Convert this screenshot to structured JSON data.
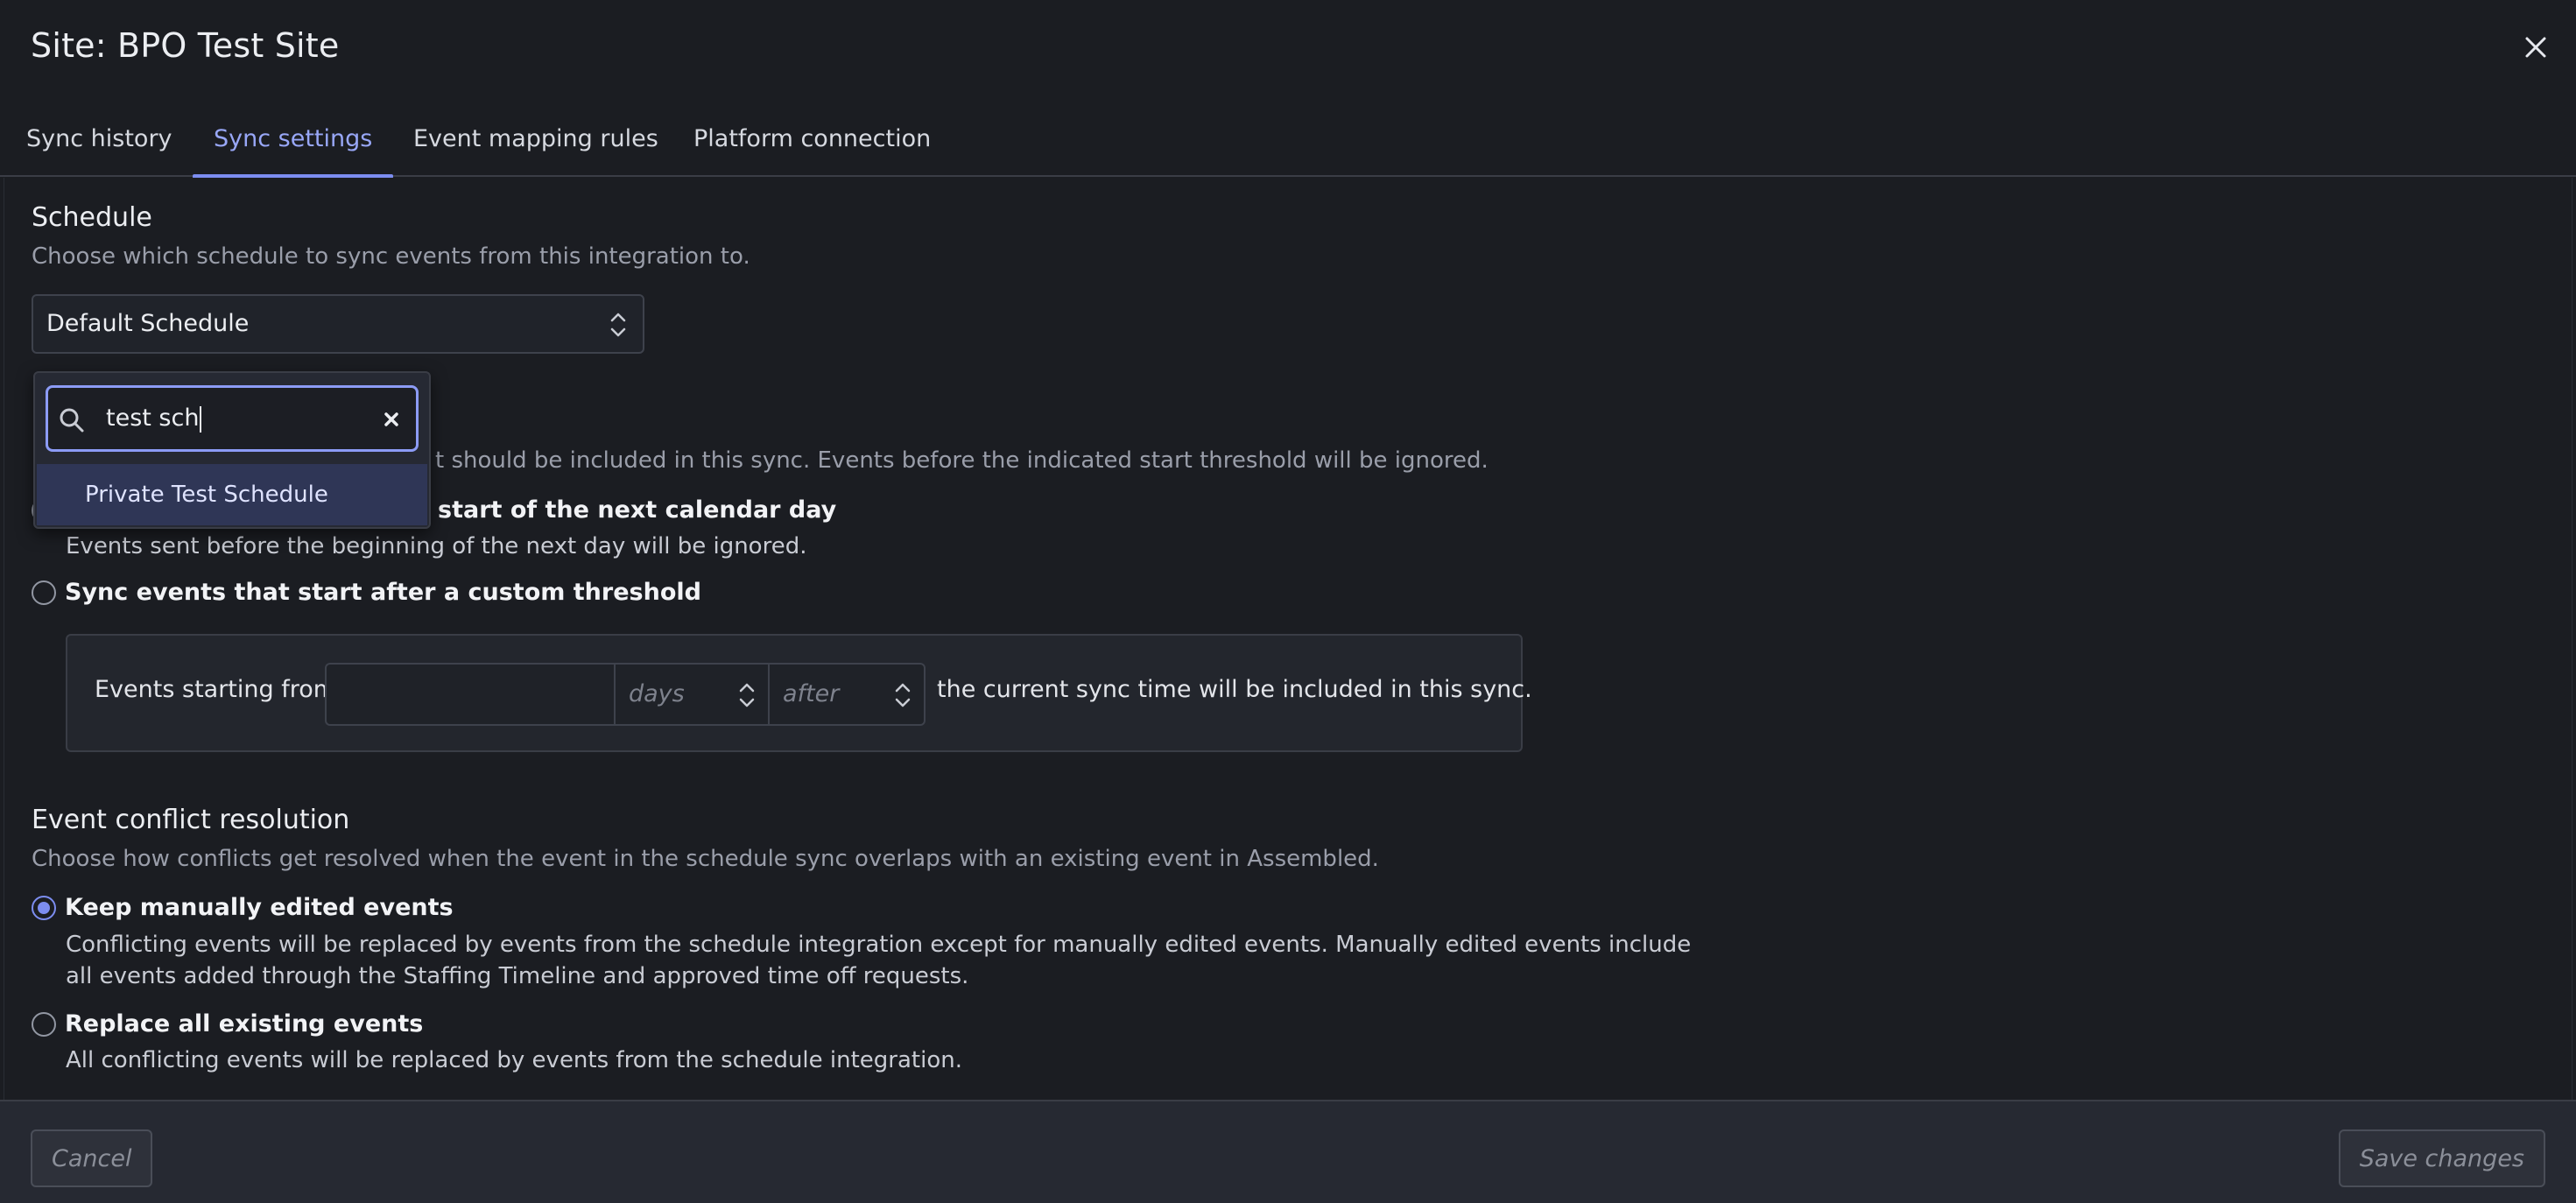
{
  "window": {
    "title": "Site: BPO Test Site"
  },
  "tabs": [
    {
      "label": "Sync history"
    },
    {
      "label": "Sync settings"
    },
    {
      "label": "Event mapping rules"
    },
    {
      "label": "Platform connection"
    }
  ],
  "active_tab": "Sync settings",
  "schedule": {
    "heading": "Schedule",
    "description": "Choose which schedule to sync events from this integration to.",
    "selected": "Default Schedule"
  },
  "schedule_dropdown": {
    "search_value": "test sch",
    "options": [
      "Private Test Schedule"
    ]
  },
  "sync_start": {
    "description_visible": "t should be included in this sync. Events before the indicated start threshold will be ignored.",
    "options": [
      {
        "label_visible": "start of the next calendar day",
        "description": "Events sent before the beginning of the next day will be ignored."
      },
      {
        "label": "Sync events that start after a custom threshold"
      }
    ],
    "threshold": {
      "prefix": "Events starting from",
      "value": "",
      "unit_placeholder": "days",
      "direction_placeholder": "after",
      "suffix": "the current sync time will be included in this sync."
    }
  },
  "conflict": {
    "heading": "Event conflict resolution",
    "description": "Choose how conflicts get resolved when the event in the schedule sync overlaps with an existing event in Assembled.",
    "options": [
      {
        "label": "Keep manually edited events",
        "description_line1": "Conflicting events will be replaced by events from the schedule integration except for manually edited events. Manually edited events include",
        "description_line2": "all events added through the Staffing Timeline and approved time off requests.",
        "checked": true
      },
      {
        "label": "Replace all existing events",
        "description": "All conflicting events will be replaced by events from the schedule integration.",
        "checked": false
      }
    ]
  },
  "footer": {
    "cancel_label": "Cancel",
    "save_label": "Save changes"
  },
  "colors": {
    "accent": "#7c8df0",
    "background": "#1b1d22",
    "footer": "#262932"
  }
}
